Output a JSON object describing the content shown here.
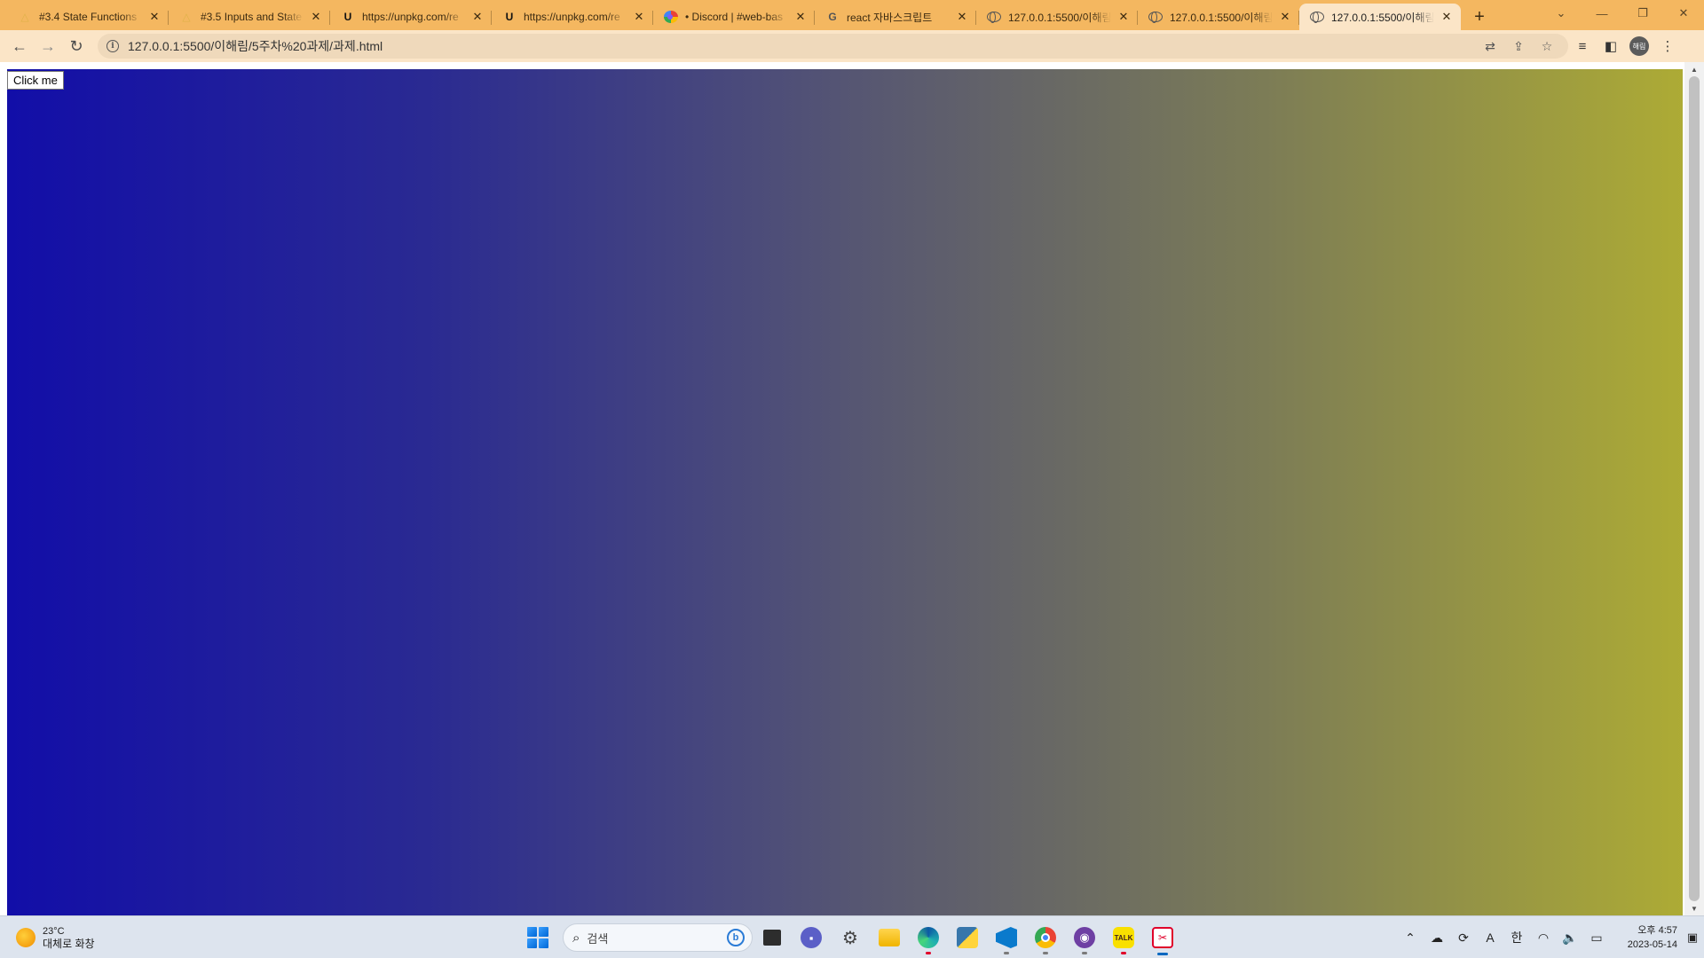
{
  "browser": {
    "tabs": [
      {
        "title": "#3.4 State Functions",
        "favicon": "mdn-icon"
      },
      {
        "title": "#3.5 Inputs and State",
        "favicon": "mdn-icon"
      },
      {
        "title": "https://unpkg.com/re",
        "favicon": "unpkg-icon"
      },
      {
        "title": "https://unpkg.com/re",
        "favicon": "unpkg-icon"
      },
      {
        "title": "• Discord | #web-bas",
        "favicon": "discord-icon"
      },
      {
        "title": "react 자바스크립트 ",
        "favicon": "google-icon"
      },
      {
        "title": "127.0.0.1:5500/이해림",
        "favicon": "globe-icon"
      },
      {
        "title": "127.0.0.1:5500/이해림",
        "favicon": "globe-icon"
      },
      {
        "title": "127.0.0.1:5500/이해림",
        "favicon": "globe-icon"
      }
    ],
    "active_tab_index": 8,
    "url": "127.0.0.1:5500/이해림/5주차%20과제/과제.html"
  },
  "page": {
    "button_label": "Click me",
    "gradient_colors": [
      "#120ea8",
      "#555573",
      "#adab35"
    ]
  },
  "taskbar": {
    "weather_temp": "23°C",
    "weather_desc": "대체로 화창",
    "search_placeholder": "검색",
    "tray_ime_a": "A",
    "tray_ime_han": "한",
    "clock_time": "오후 4:57",
    "clock_date": "2023-05-14",
    "chrome_profile_badge": "해림"
  },
  "colors": {
    "tabstrip": "#f4b760",
    "toolbar": "#fbe5c7",
    "taskbar": "#dde4ee"
  }
}
